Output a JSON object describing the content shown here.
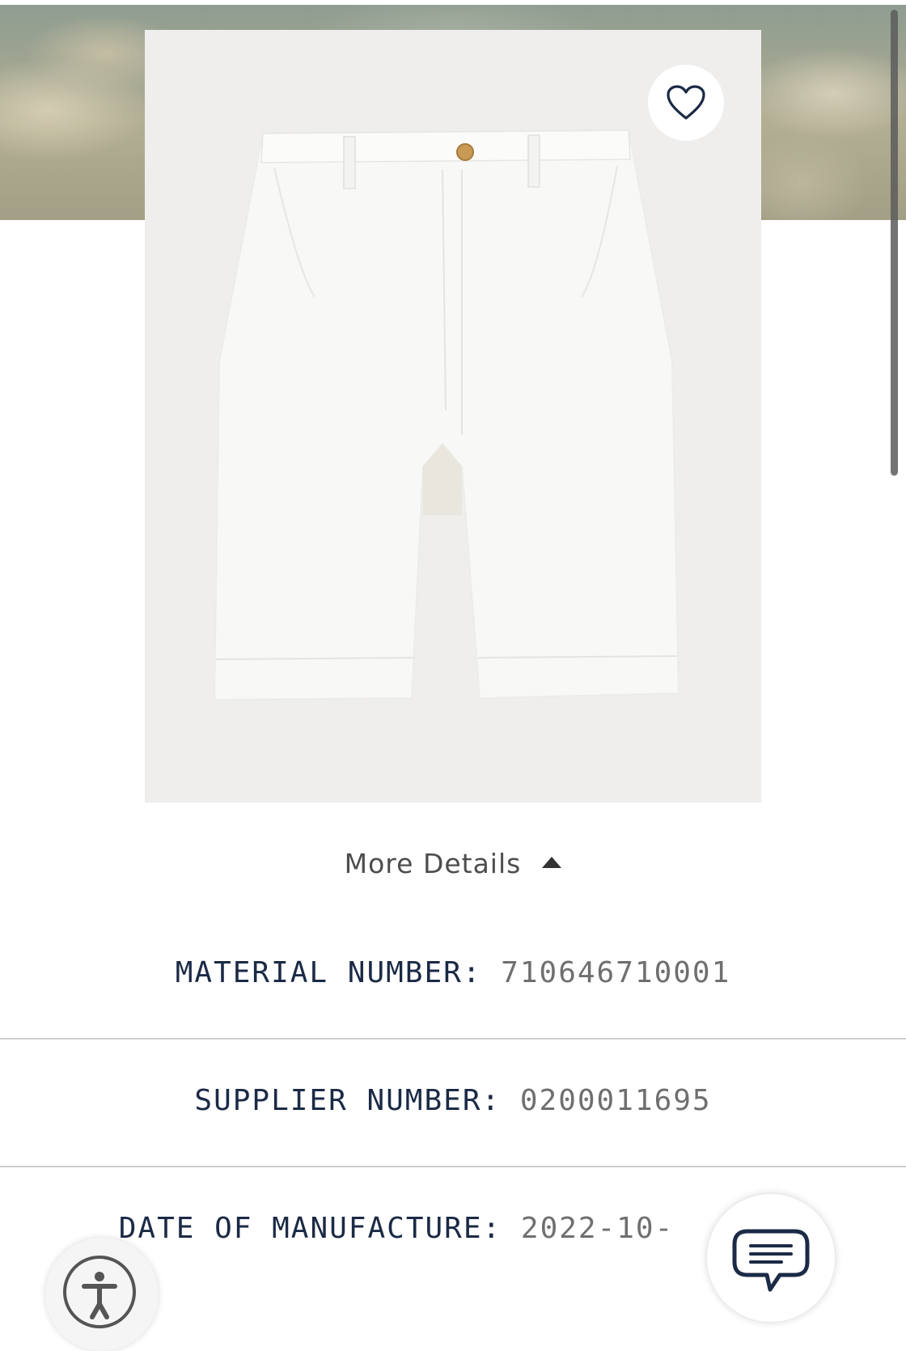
{
  "product": {
    "image_alt": "White chino shorts",
    "wishlist_icon": "heart-outline-icon"
  },
  "details": {
    "toggle_label": "More Details",
    "toggle_icon": "caret-up-icon",
    "rows": [
      {
        "label": "MATERIAL NUMBER:",
        "value": "710646710001"
      },
      {
        "label": "SUPPLIER NUMBER:",
        "value": "0200011695"
      },
      {
        "label": "DATE OF MANUFACTURE:",
        "value": "2022-10-"
      }
    ]
  },
  "floating": {
    "chat_icon": "chat-bubble-icon",
    "accessibility_icon": "accessibility-icon"
  },
  "colors": {
    "label": "#1b2a45",
    "value": "#6f6f6f",
    "card_bg": "#efeeec"
  }
}
